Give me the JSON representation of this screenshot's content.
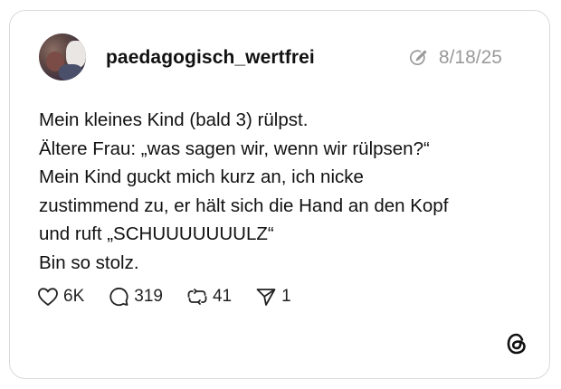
{
  "post": {
    "username": "paedagogisch_wertfrei",
    "date": "8/18/25",
    "text_lines": [
      "Mein kleines Kind (bald 3) rülpst.",
      "Ältere Frau: „was sagen wir, wenn wir rülpsen?“",
      "Mein Kind guckt mich kurz an, ich nicke",
      "zustimmend zu, er hält sich die Hand an den Kopf",
      "und ruft „SCHUUUUUUULZ“",
      "Bin so stolz."
    ]
  },
  "actions": {
    "like_count": "6K",
    "reply_count": "319",
    "repost_count": "41",
    "share_count": "1"
  },
  "icons": {
    "edited": "edited-pencil-icon",
    "like": "heart-icon",
    "reply": "speech-bubble-icon",
    "repost": "repost-arrows-icon",
    "share": "paper-plane-icon",
    "brand": "threads-logo-icon"
  },
  "colors": {
    "text": "#111111",
    "muted": "#9a9a9a",
    "border": "#d9d9d9"
  }
}
